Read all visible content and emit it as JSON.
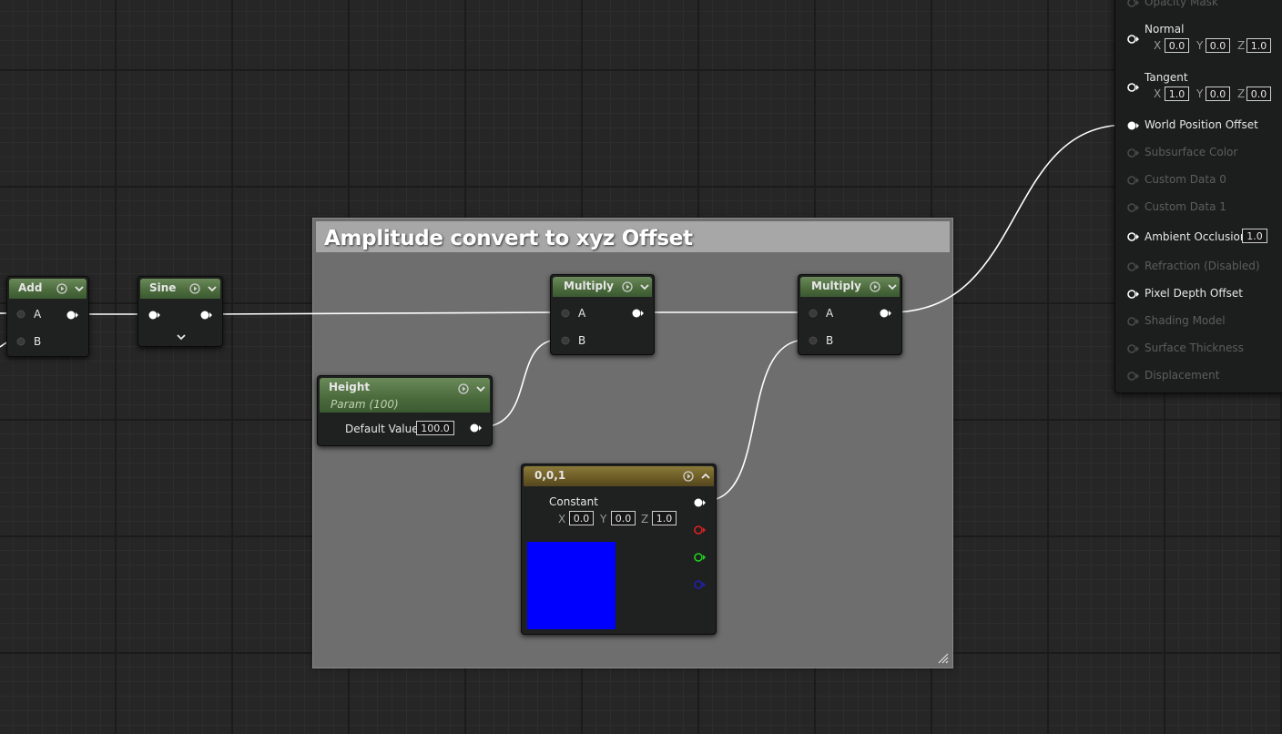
{
  "comment": {
    "title": "Amplitude convert to xyz Offset"
  },
  "nodes": {
    "add": {
      "title": "Add",
      "pin_a": "A",
      "pin_b": "B"
    },
    "sine": {
      "title": "Sine"
    },
    "multiply1": {
      "title": "Multiply",
      "pin_a": "A",
      "pin_b": "B"
    },
    "multiply2": {
      "title": "Multiply",
      "pin_a": "A",
      "pin_b": "B"
    },
    "height": {
      "title": "Height",
      "subtitle": "Param (100)",
      "default_label": "Default Value",
      "default_value": "100.0"
    },
    "constant": {
      "title": "0,0,1",
      "label": "Constant",
      "x_label": "X",
      "x_value": "0.0",
      "y_label": "Y",
      "y_value": "0.0",
      "z_label": "Z",
      "z_value": "1.0",
      "preview_color": "#0000ff"
    }
  },
  "result": {
    "opacity_mask": "Opacity Mask",
    "normal": {
      "label": "Normal",
      "x_label": "X",
      "x": "0.0",
      "y_label": "Y",
      "y": "0.0",
      "z_label": "Z",
      "z": "1.0"
    },
    "tangent": {
      "label": "Tangent",
      "x_label": "X",
      "x": "1.0",
      "y_label": "Y",
      "y": "0.0",
      "z_label": "Z",
      "z": "0.0"
    },
    "world_position_offset": "World Position Offset",
    "subsurface_color": "Subsurface Color",
    "custom_data_0": "Custom Data 0",
    "custom_data_1": "Custom Data 1",
    "ambient_occlusion": {
      "label": "Ambient Occlusion",
      "value": "1.0"
    },
    "refraction": "Refraction (Disabled)",
    "pixel_depth_offset": "Pixel Depth Offset",
    "shading_model": "Shading Model",
    "surface_thickness": "Surface Thickness",
    "displacement": "Displacement"
  },
  "colors": {
    "wire": "#ffffff",
    "pin_red": "#e02020",
    "pin_green": "#20d020",
    "pin_blue": "#2020c0",
    "node_header_green": "#4a6a3c",
    "node_header_gold": "#6b5a24",
    "comment_bg": "#6e6e6e"
  }
}
